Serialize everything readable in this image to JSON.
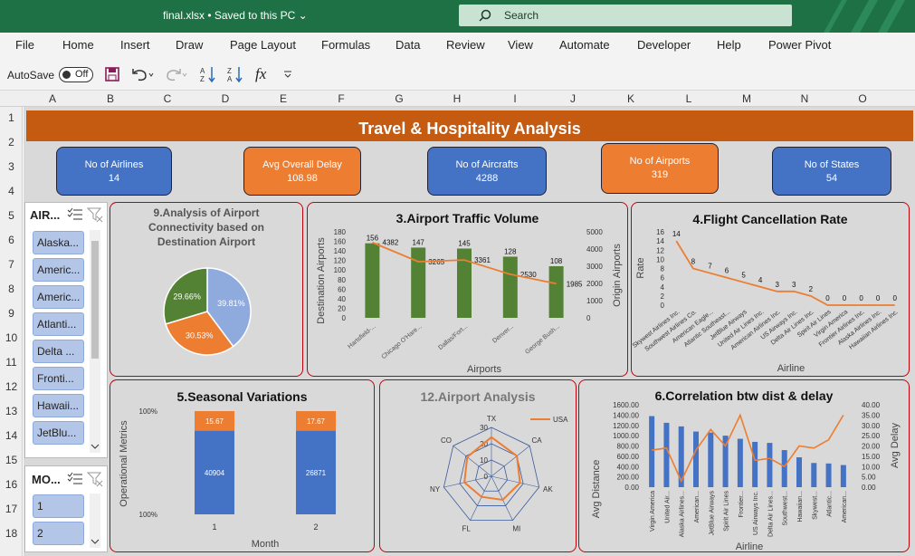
{
  "titlebar": {
    "file": "final.xlsx • Saved to this PC ⌄",
    "search": "Search"
  },
  "menu": [
    "File",
    "Home",
    "Insert",
    "Draw",
    "Page Layout",
    "Formulas",
    "Data",
    "Review",
    "View",
    "Automate",
    "Developer",
    "Help",
    "Power Pivot"
  ],
  "qat": {
    "autosave": "AutoSave",
    "toggle": "Off"
  },
  "columns": [
    "A",
    "B",
    "C",
    "D",
    "E",
    "F",
    "G",
    "H",
    "I",
    "J",
    "K",
    "L",
    "M",
    "N",
    "O"
  ],
  "rows": [
    "1",
    "2",
    "3",
    "4",
    "5",
    "6",
    "7",
    "8",
    "9",
    "10",
    "11",
    "12",
    "13",
    "14",
    "15",
    "16",
    "17",
    "18"
  ],
  "banner": "Travel & Hospitality Analysis",
  "kpis": [
    {
      "label": "No of Airlines",
      "value": "14",
      "color": "blue"
    },
    {
      "label": "Avg Overall Delay",
      "value": "108.98",
      "color": "orange"
    },
    {
      "label": "No of Aircrafts",
      "value": "4288",
      "color": "blue"
    },
    {
      "label": "No of Airports",
      "value": "319",
      "color": "orange"
    },
    {
      "label": "No of States",
      "value": "54",
      "color": "blue"
    }
  ],
  "slicer_airline": {
    "title": "AIR...",
    "items": [
      "Alaska...",
      "Americ...",
      "Americ...",
      "Atlanti...",
      "Delta ...",
      "Fronti...",
      "Hawaii...",
      "JetBlu..."
    ]
  },
  "slicer_month": {
    "title": "MO...",
    "items": [
      "1",
      "2"
    ]
  },
  "panels": {
    "p9": "9.Analysis of Airport Connectivity based on Destination Airport",
    "p3": "3.Airport Traffic Volume",
    "p4": "4.Flight Cancellation Rate",
    "p5": "5.Seasonal Variations",
    "p12": "12.Airport Analysis",
    "p6": "6.Correlation btw dist & delay"
  },
  "chart_data": [
    {
      "id": "pie9",
      "type": "pie",
      "values": [
        39.81,
        30.53,
        29.66
      ],
      "labels": [
        "39.81%",
        "30.53%",
        "29.66%"
      ],
      "colors": [
        "#8faadc",
        "#ed7d31",
        "#548235"
      ]
    },
    {
      "id": "traffic3",
      "type": "bar",
      "categories": [
        "Hartsfield-...",
        "Chicago O'Hare...",
        "Dallas/Fort...",
        "Denver...",
        "George Bush..."
      ],
      "series": [
        {
          "values": [
            156,
            147,
            145,
            128,
            108
          ],
          "color": "#548235"
        },
        {
          "values": [
            4382,
            3265,
            3361,
            2530,
            1985
          ],
          "color": "#ed7d31"
        }
      ],
      "xlabel": "Airports",
      "ylabel": "Destination Airports",
      "y2label": "Origin Airports",
      "ylim": [
        0,
        180
      ],
      "y2lim": [
        0,
        5000
      ],
      "yticks": [
        "0",
        "20",
        "40",
        "60",
        "80",
        "100",
        "120",
        "140",
        "160",
        "180"
      ],
      "y2ticks": [
        "0",
        "1000",
        "2000",
        "3000",
        "4000",
        "5000"
      ]
    },
    {
      "id": "cancel4",
      "type": "line",
      "categories": [
        "Skywest Airlines Inc.",
        "Southwest Airlines Co.",
        "American Eagle...",
        "Atlantic Southeast...",
        "JetBlue Airways",
        "United Air Lines Inc.",
        "American Airlines Inc.",
        "US Airways Inc.",
        "Delta Air Lines Inc.",
        "Spirit Air Lines",
        "Virgin America",
        "Frontier Airlines Inc.",
        "Alaska Airlines Inc.",
        "Hawaiian Airlines Inc."
      ],
      "values": [
        14,
        8,
        7,
        6,
        5,
        4,
        3,
        3,
        2,
        0,
        0,
        0,
        0,
        0
      ],
      "xlabel": "Airline",
      "ylabel": "Rate",
      "ylim": [
        0,
        16
      ],
      "yticks": [
        "0",
        "2",
        "4",
        "6",
        "8",
        "10",
        "12",
        "14",
        "16"
      ],
      "color": "#ed7d31"
    },
    {
      "id": "season5",
      "type": "bar",
      "categories": [
        "1",
        "2"
      ],
      "series": [
        {
          "values": [
            40904,
            26871
          ],
          "color": "#4472c4"
        },
        {
          "values": [
            15.67,
            17.67
          ],
          "color": "#ed7d31"
        }
      ],
      "xlabel": "Month",
      "ylabel": "Operational Metrics",
      "yticks": [
        "100%",
        "100%"
      ]
    },
    {
      "id": "radar12",
      "type": "radar",
      "axes": [
        "TX",
        "CA",
        "AK",
        "MI",
        "FL",
        "NY",
        "CO"
      ],
      "rticks": [
        "0",
        "10",
        "20",
        "30"
      ],
      "series": [
        {
          "name": "USA",
          "values": [
            24,
            20,
            18,
            16,
            14,
            17,
            19
          ],
          "color": "#ed7d31"
        }
      ]
    },
    {
      "id": "corr6",
      "type": "bar",
      "categories": [
        "Virgin America",
        "United Air...",
        "Alaska Airlines...",
        "American...",
        "JetBlue Airways",
        "Spirit Air Lines",
        "Frontier...",
        "US Airways Inc.",
        "Delta Air Lines...",
        "Southwest...",
        "Hawaiian...",
        "Skywest...",
        "Atlantic...",
        "American..."
      ],
      "series": [
        {
          "values": [
            1380,
            1250,
            1180,
            1080,
            1060,
            1000,
            940,
            880,
            860,
            720,
            580,
            470,
            460,
            430
          ],
          "color": "#4472c4"
        },
        {
          "values": [
            18,
            19,
            3,
            18,
            28,
            20,
            35,
            13,
            14,
            10,
            20,
            19,
            23,
            35
          ],
          "color": "#ed7d31"
        }
      ],
      "xlabel": "Airline",
      "ylabel": "Avg Distance",
      "y2label": "Avg Delay",
      "yticks": [
        "0.00",
        "200.00",
        "400.00",
        "600.00",
        "800.00",
        "1000.00",
        "1200.00",
        "1400.00",
        "1600.00"
      ],
      "y2ticks": [
        "0.00",
        "5.00",
        "10.00",
        "15.00",
        "20.00",
        "25.00",
        "30.00",
        "35.00",
        "40.00"
      ],
      "ylim": [
        0,
        1600
      ],
      "y2lim": [
        0,
        40
      ]
    }
  ]
}
